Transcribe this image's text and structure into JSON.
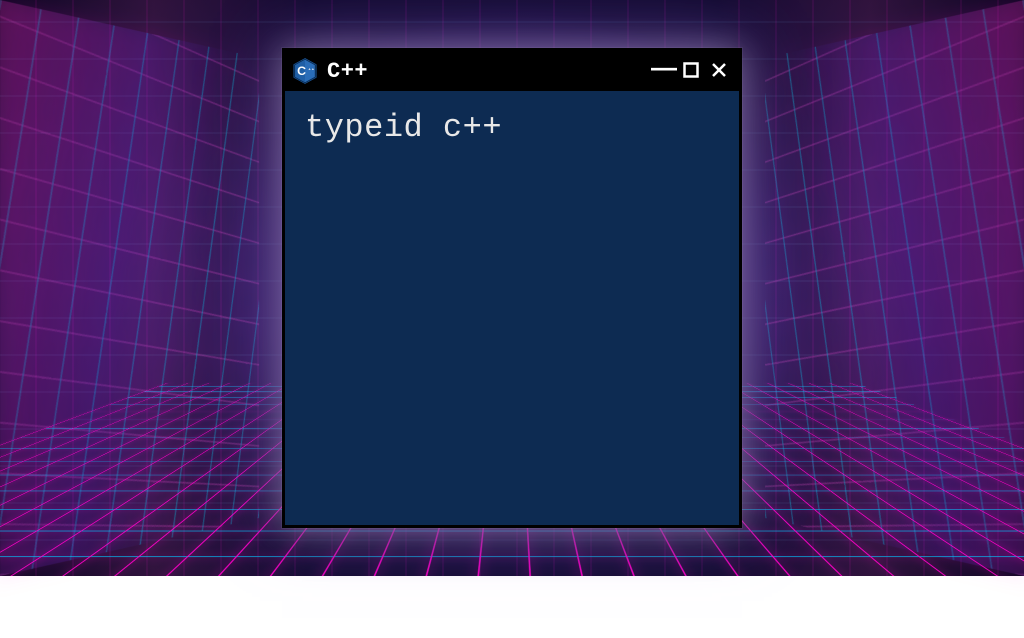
{
  "window": {
    "title": "C++",
    "icon_letter": "C",
    "icon_plus": "++",
    "controls": {
      "minimize": "–",
      "maximize": "☐",
      "close": "✕"
    }
  },
  "content": {
    "text": "typeid c++"
  },
  "colors": {
    "titlebar_bg": "#000000",
    "window_bg": "#0d2b52",
    "text": "#e8e8e8",
    "icon_bg": "#1f5fa6",
    "icon_border": "#0a2c54"
  }
}
